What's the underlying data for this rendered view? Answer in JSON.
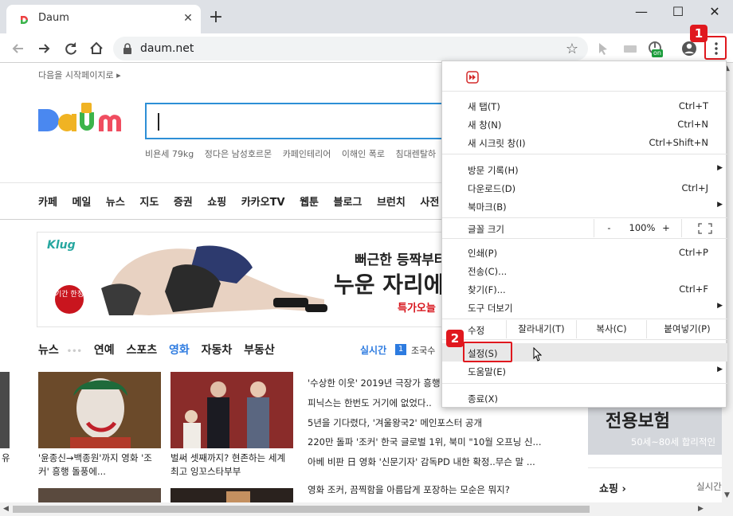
{
  "browser": {
    "tab_title": "Daum",
    "tab_close": "✕",
    "new_tab": "+",
    "window_controls": {
      "minimize": "—",
      "maximize": "☐",
      "close": "✕"
    },
    "url": "daum.net",
    "ext_on_label": "on",
    "annotations": {
      "badge1": "1",
      "badge2": "2"
    },
    "accent_color": "#e0181e"
  },
  "page": {
    "start_page_link": "다음을 시작페이지로 ▸",
    "logo_text": "Daum",
    "trends": [
      "비욘세 79kg",
      "정다은 남성호르몬",
      "카페인테리어",
      "이해인 폭로",
      "침대렌탈하"
    ],
    "gnb": [
      "카페",
      "메일",
      "뉴스",
      "지도",
      "증권",
      "쇼핑",
      "카카오TV",
      "웹툰",
      "블로그",
      "브런치",
      "사전"
    ],
    "ad": {
      "brand": "Klug",
      "sticker": "기간 한정",
      "line1": "뻐근한 등짝부터",
      "line2": "누운 자리에",
      "line3": "특가오늘"
    },
    "news_tabs": [
      "뉴스",
      "•••",
      "연예",
      "스포츠",
      "영화",
      "자동차",
      "부동산"
    ],
    "news_tab_active": "영화",
    "realtime_label": "실시간",
    "realtime_rank": "1",
    "realtime_word": "조국수",
    "left_edge_caption": "유",
    "thumb_captions": [
      "'윤종신→백종원'까지 영화 '조커' 흥행 돌풍에...",
      "벌써 셋째까지? 현존하는 세계최고 잉꼬스타부부"
    ],
    "headlines": [
      "'수상한 이웃' 2019년 극장가 흥행",
      "피닉스는 한번도 거기에 없었다..",
      "5년을 기다렸다, '겨울왕국2' 메인포스터 공개",
      "220만 돌파 '조커' 한국 글로벌 1위, 북미 \"10월 오프닝 신...",
      "아베 비판 日 영화 '신문기자' 감독PD 내한 확정..무슨 말 ...",
      "영화 조커, 끔찍함을 아름답게 포장하는 모순은 뭐지?"
    ],
    "insurance": {
      "title": "전용보험",
      "subtitle": "50세~80세 합리적인"
    },
    "shopping": "쇼핑 ›",
    "shopping_right": "실시간"
  },
  "menu": {
    "items": [
      {
        "label": "새 탭(T)",
        "shortcut": "Ctrl+T"
      },
      {
        "label": "새 창(N)",
        "shortcut": "Ctrl+N"
      },
      {
        "label": "새 시크릿 창(I)",
        "shortcut": "Ctrl+Shift+N"
      },
      {
        "label": "방문 기록(H)",
        "shortcut": ""
      },
      {
        "label": "다운로드(D)",
        "shortcut": "Ctrl+J"
      },
      {
        "label": "북마크(B)",
        "shortcut": ""
      },
      {
        "label": "인쇄(P)",
        "shortcut": "Ctrl+P"
      },
      {
        "label": "전송(C)...",
        "shortcut": ""
      },
      {
        "label": "찾기(F)...",
        "shortcut": "Ctrl+F"
      },
      {
        "label": "도구 더보기",
        "shortcut": ""
      },
      {
        "label": "설정(S)",
        "shortcut": ""
      },
      {
        "label": "도움말(E)",
        "shortcut": ""
      },
      {
        "label": "종료(X)",
        "shortcut": ""
      }
    ],
    "zoom": {
      "label": "글꼴 크기",
      "minus": "-",
      "value": "100%",
      "plus": "+"
    },
    "edit": {
      "label": "수정",
      "cut": "잘라내기(T)",
      "copy": "복사(C)",
      "paste": "붙여넣기(P)"
    },
    "submenu_arrow": "▶"
  }
}
